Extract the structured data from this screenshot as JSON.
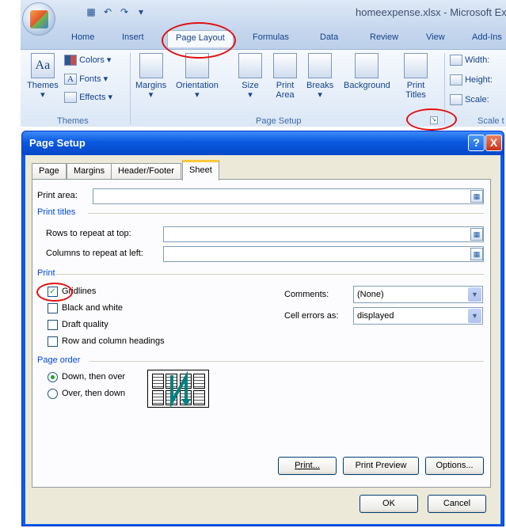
{
  "excel": {
    "window_title": "homeexpense.xlsx - Microsoft Exc",
    "tabs": [
      "Home",
      "Insert",
      "Page Layout",
      "Formulas",
      "Data",
      "Review",
      "View",
      "Add-Ins"
    ],
    "active_tab": "Page Layout",
    "themes_group": {
      "themes": "Themes",
      "colors": "Colors",
      "fonts": "Fonts",
      "effects": "Effects",
      "label": "Themes"
    },
    "page_setup_group": {
      "margins": "Margins",
      "orientation": "Orientation",
      "size": "Size",
      "print_area": "Print Area",
      "breaks": "Breaks",
      "background": "Background",
      "print_titles": "Print Titles",
      "label": "Page Setup"
    },
    "scale_group": {
      "width": "Width:",
      "height": "Height:",
      "scale": "Scale:",
      "label": "Scale t"
    },
    "launcher_icon": "dialog-launcher-icon"
  },
  "dialog": {
    "title": "Page Setup",
    "help": "?",
    "close": "X",
    "tabs": [
      "Page",
      "Margins",
      "Header/Footer",
      "Sheet"
    ],
    "active_tab": "Sheet",
    "print_area_label": "Print area:",
    "print_area_value": "",
    "print_titles_section": "Print titles",
    "rows_repeat_label": "Rows to repeat at top:",
    "rows_repeat_value": "",
    "cols_repeat_label": "Columns to repeat at left:",
    "cols_repeat_value": "",
    "print_section": "Print",
    "gridlines": {
      "label": "Gridlines",
      "checked": true
    },
    "black_white": {
      "label": "Black and white",
      "checked": false
    },
    "draft_quality": {
      "label": "Draft quality",
      "checked": false
    },
    "row_col_headings": {
      "label": "Row and column headings",
      "checked": false
    },
    "comments_label": "Comments:",
    "comments_value": "(None)",
    "cell_errors_label": "Cell errors as:",
    "cell_errors_value": "displayed",
    "page_order_section": "Page order",
    "down_then_over": {
      "label": "Down, then over",
      "selected": true
    },
    "over_then_down": {
      "label": "Over, then down",
      "selected": false
    },
    "buttons": {
      "print": "Print...",
      "print_preview": "Print Preview",
      "options": "Options...",
      "ok": "OK",
      "cancel": "Cancel"
    }
  },
  "colors": {
    "accent_blue": "#0a5ce4",
    "callout_red": "#e01010",
    "check_green": "#21a121",
    "section_blue": "#0046d5"
  }
}
